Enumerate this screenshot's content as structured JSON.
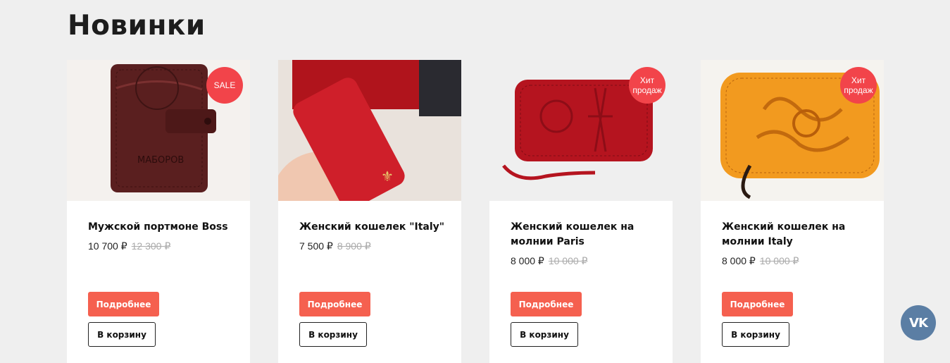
{
  "section": {
    "title": "Новинки"
  },
  "products": [
    {
      "name": "Мужской портмоне Boss",
      "price": "10 700 ₽",
      "old_price": "12 300 ₽",
      "badge": "SALE",
      "image_text": "МАБОРОВ",
      "more": "Подробнее",
      "cart": "В корзину"
    },
    {
      "name": "Женский кошелек \"Italy\"",
      "price": "7 500 ₽",
      "old_price": "8 900 ₽",
      "badge": "",
      "more": "Подробнее",
      "cart": "В корзину"
    },
    {
      "name": "Женский кошелек на молнии Paris",
      "price": "8 000 ₽",
      "old_price": "10 000 ₽",
      "badge": "Хит продаж",
      "more": "Подробнее",
      "cart": "В корзину"
    },
    {
      "name": "Женский кошелек на молнии Italy",
      "price": "8 000 ₽",
      "old_price": "10 000 ₽",
      "badge": "Хит продаж",
      "more": "Подробнее",
      "cart": "В корзину"
    }
  ],
  "vk": {
    "label": "VK",
    "icon": "vk-icon",
    "color": "#5b7ea4"
  },
  "colors": {
    "accent": "#f5604f",
    "badge": "#f2444a",
    "background": "#efefef"
  }
}
